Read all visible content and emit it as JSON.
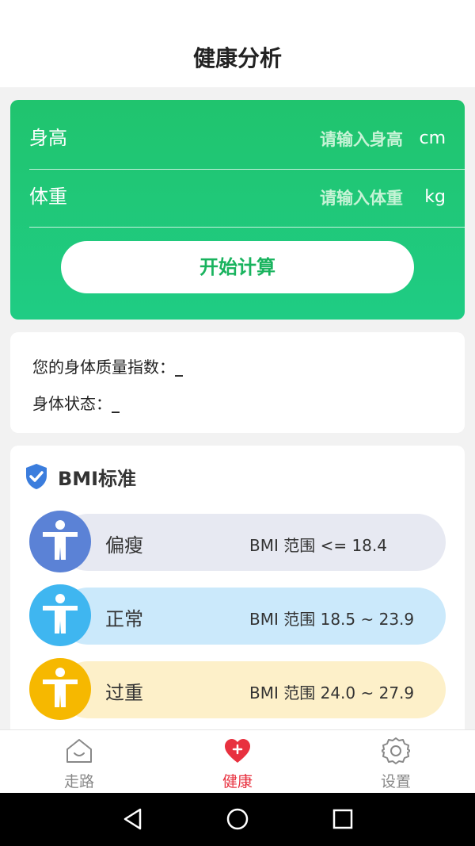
{
  "header": {
    "title": "健康分析"
  },
  "form": {
    "height_label": "身高",
    "height_placeholder": "请输入身高",
    "height_unit": "cm",
    "weight_label": "体重",
    "weight_placeholder": "请输入体重",
    "weight_unit": "kg",
    "calc_button": "开始计算"
  },
  "result": {
    "bmi_label": "您的身体质量指数：",
    "bmi_value": "_",
    "status_label": "身体状态：",
    "status_value": "_"
  },
  "bmi_standard": {
    "title": "BMI标准",
    "icon": "shield-check-icon",
    "items": [
      {
        "name": "偏瘦",
        "range": "BMI 范围 <= 18.4",
        "circle_color": "#5b82d6",
        "pill_color": "#e7e9f2"
      },
      {
        "name": "正常",
        "range": "BMI 范围 18.5 ~ 23.9",
        "circle_color": "#3fb6f0",
        "pill_color": "#cbe9fb"
      },
      {
        "name": "过重",
        "range": "BMI 范围 24.0 ~ 27.9",
        "circle_color": "#f6b800",
        "pill_color": "#fdf0c9"
      }
    ]
  },
  "nav": {
    "walk": "走路",
    "health": "健康",
    "settings": "设置",
    "active_color": "#e8313f",
    "inactive_color": "#888888"
  }
}
